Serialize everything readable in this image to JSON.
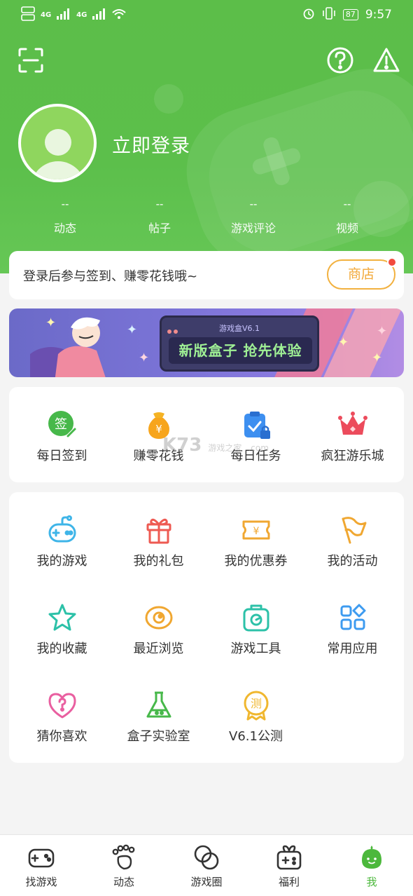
{
  "status_bar": {
    "time": "9:57",
    "battery": "87",
    "network_a": "4G",
    "network_b": "4G"
  },
  "profile": {
    "login_text": "立即登录",
    "stats": [
      {
        "value": "--",
        "label": "动态"
      },
      {
        "value": "--",
        "label": "帖子"
      },
      {
        "value": "--",
        "label": "游戏评论"
      },
      {
        "value": "--",
        "label": "视频"
      }
    ]
  },
  "login_bar": {
    "tip": "登录后参与签到、赚零花钱哦~",
    "shop_label": "商店"
  },
  "banner": {
    "small_text": "游戏盒V6.1",
    "big_text": "新版盒子 抢先体验"
  },
  "quick_actions": [
    {
      "label": "每日签到",
      "icon": "sign-in-icon",
      "glyph": "签"
    },
    {
      "label": "赚零花钱",
      "icon": "money-bag-icon",
      "glyph": "¥"
    },
    {
      "label": "每日任务",
      "icon": "task-clipboard-icon"
    },
    {
      "label": "疯狂游乐城",
      "icon": "crown-icon"
    }
  ],
  "menu": [
    {
      "label": "我的游戏",
      "icon": "gamepad-icon"
    },
    {
      "label": "我的礼包",
      "icon": "gift-icon"
    },
    {
      "label": "我的优惠券",
      "icon": "coupon-icon"
    },
    {
      "label": "我的活动",
      "icon": "flag-icon"
    },
    {
      "label": "我的收藏",
      "icon": "star-icon"
    },
    {
      "label": "最近浏览",
      "icon": "eye-icon"
    },
    {
      "label": "游戏工具",
      "icon": "toolbox-icon"
    },
    {
      "label": "常用应用",
      "icon": "apps-grid-icon"
    },
    {
      "label": "猜你喜欢",
      "icon": "heart-question-icon"
    },
    {
      "label": "盒子实验室",
      "icon": "flask-icon"
    },
    {
      "label": "V6.1公测",
      "icon": "beta-badge-icon",
      "glyph": "测"
    }
  ],
  "watermark": {
    "brand": "K73",
    "sub": "游戏之家",
    "domain": ".com"
  },
  "tabbar": [
    {
      "label": "找游戏",
      "icon": "gamepad-tab-icon"
    },
    {
      "label": "动态",
      "icon": "footprint-icon"
    },
    {
      "label": "游戏圈",
      "icon": "circles-icon"
    },
    {
      "label": "福利",
      "icon": "gift-box-tab-icon"
    },
    {
      "label": "我",
      "icon": "mascot-icon",
      "active": true
    }
  ],
  "colors": {
    "brand_green": "#5cbe49",
    "accent_orange": "#f2b13f",
    "badge_red": "#f24a3d"
  }
}
